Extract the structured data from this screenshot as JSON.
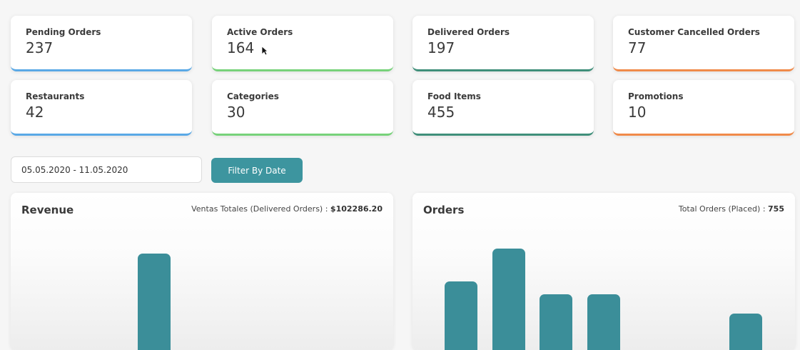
{
  "stats": [
    {
      "label": "Pending Orders",
      "value": "237",
      "accent": "#5aa9e6"
    },
    {
      "label": "Active Orders",
      "value": "164",
      "accent": "#77d27a"
    },
    {
      "label": "Delivered Orders",
      "value": "197",
      "accent": "#3f8f7a"
    },
    {
      "label": "Customer Cancelled Orders",
      "value": "77",
      "accent": "#f08a49"
    },
    {
      "label": "Restaurants",
      "value": "42",
      "accent": "#5aa9e6"
    },
    {
      "label": "Categories",
      "value": "30",
      "accent": "#77d27a"
    },
    {
      "label": "Food Items",
      "value": "455",
      "accent": "#3f8f7a"
    },
    {
      "label": "Promotions",
      "value": "10",
      "accent": "#f08a49"
    }
  ],
  "filter": {
    "date_range": "05.05.2020 - 11.05.2020",
    "button_label": "Filter By Date",
    "button_color": "#3d959f"
  },
  "revenue": {
    "title": "Revenue",
    "summary_label": "Ventas Totales (Delivered Orders) :",
    "summary_value": "$102286.20"
  },
  "orders": {
    "title": "Orders",
    "summary_label": "Total Orders (Placed) :",
    "summary_value": "755"
  },
  "chart_data": [
    {
      "type": "bar",
      "title": "Revenue",
      "series": [
        {
          "values": [
            null,
            null,
            125,
            null,
            null,
            null,
            null
          ]
        }
      ],
      "bar_color": "#3b8e99",
      "note_cropped": true
    },
    {
      "type": "bar",
      "title": "Orders",
      "series": [
        {
          "values": [
            86,
            132,
            68,
            68,
            null,
            null,
            41
          ]
        }
      ],
      "bar_color": "#3b8e99",
      "note_cropped": true
    }
  ]
}
